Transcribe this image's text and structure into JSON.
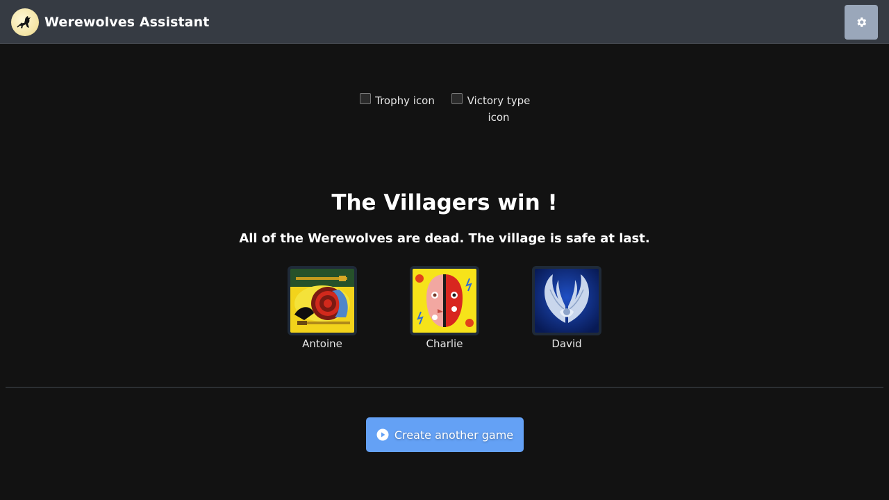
{
  "app": {
    "title": "Werewolves Assistant",
    "accent": "#64a1f5",
    "navbar_color": "#363b43"
  },
  "header": {
    "logo_icon": "werewolf-moon-logo-icon",
    "settings_icon": "gear-icon"
  },
  "result": {
    "trophy_alt": "Trophy icon",
    "victory_alt": "Victory type icon",
    "title": "The Villagers win !",
    "description": "All of the Werewolves are dead. The village is safe at last."
  },
  "winners": [
    {
      "name": "Antoine",
      "role_icon": "hunter-role-icon"
    },
    {
      "name": "Charlie",
      "role_icon": "two-faced-role-icon"
    },
    {
      "name": "David",
      "role_icon": "angel-wings-role-icon"
    }
  ],
  "actions": {
    "create_game_label": "Create another game",
    "create_game_icon": "play-circle-icon"
  }
}
